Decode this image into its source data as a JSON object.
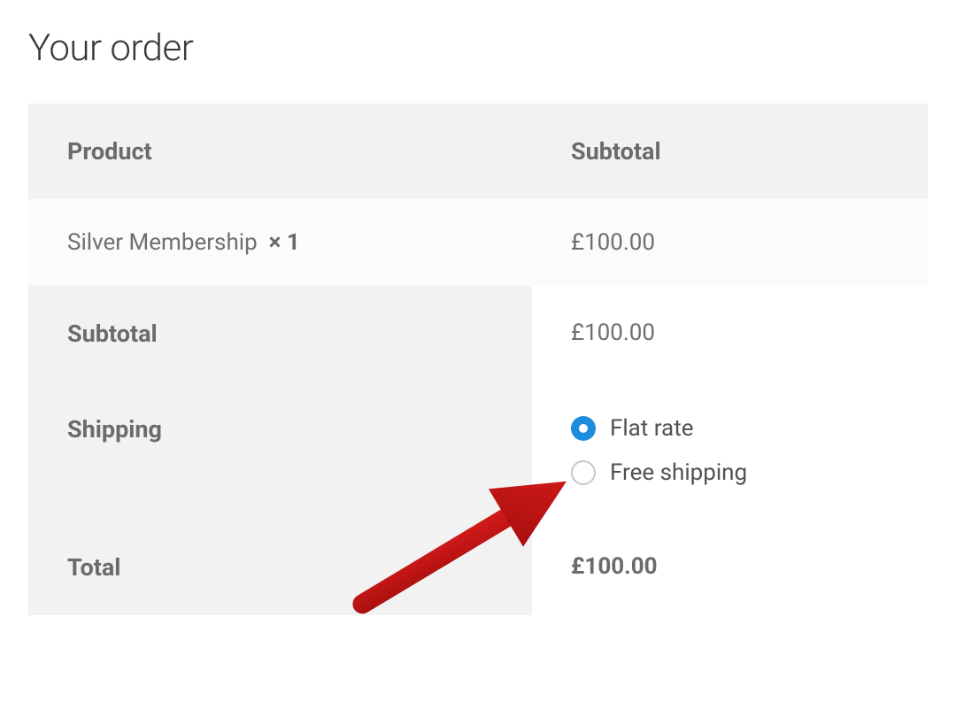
{
  "title": "Your order",
  "headers": {
    "product": "Product",
    "subtotal": "Subtotal"
  },
  "item": {
    "name": "Silver Membership",
    "qty_prefix": "×",
    "qty": "1",
    "subtotal": "£100.00"
  },
  "rows": {
    "subtotal_label": "Subtotal",
    "subtotal_value": "£100.00",
    "shipping_label": "Shipping",
    "total_label": "Total",
    "total_value": "£100.00"
  },
  "shipping": {
    "options": [
      {
        "label": "Flat rate",
        "selected": true
      },
      {
        "label": "Free shipping",
        "selected": false
      }
    ]
  },
  "colors": {
    "accent": "#1e8cdd",
    "annotation": "#c11414"
  }
}
